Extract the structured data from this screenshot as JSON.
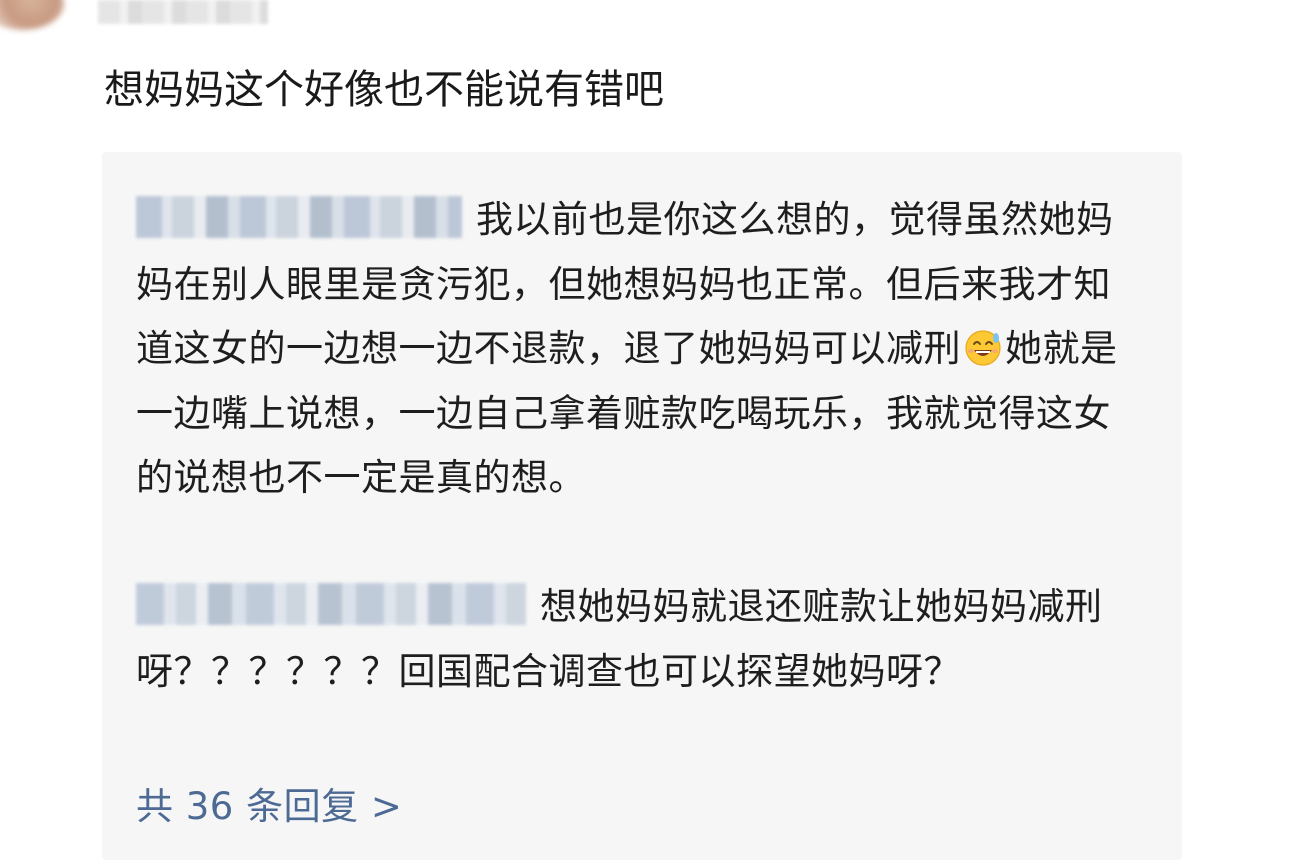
{
  "comment": {
    "text": "想妈妈这个好像也不能说有错吧"
  },
  "replies": [
    {
      "text_before_emoji": "我以前也是你这么想的，觉得虽然她妈妈在别人眼里是贪污犯，但她想妈妈也正常。但后来我才知道这女的一边想一边不退款，退了她妈妈可以减刑",
      "emoji_icon": "grinning-sweat-emoji-icon",
      "text_after_emoji": "她就是一边嘴上说想，一边自己拿着赃款吃喝玩乐，我就觉得这女的说想也不一定是真的想。"
    },
    {
      "text": "想她妈妈就退还赃款让她妈妈减刑呀？？？？？？回国配合调查也可以探望她妈呀？"
    }
  ],
  "more_replies_label": "共 36 条回复 >",
  "colors": {
    "link": "#4d6a94",
    "reply_background": "#f6f6f6",
    "text": "#1e1e1e"
  }
}
